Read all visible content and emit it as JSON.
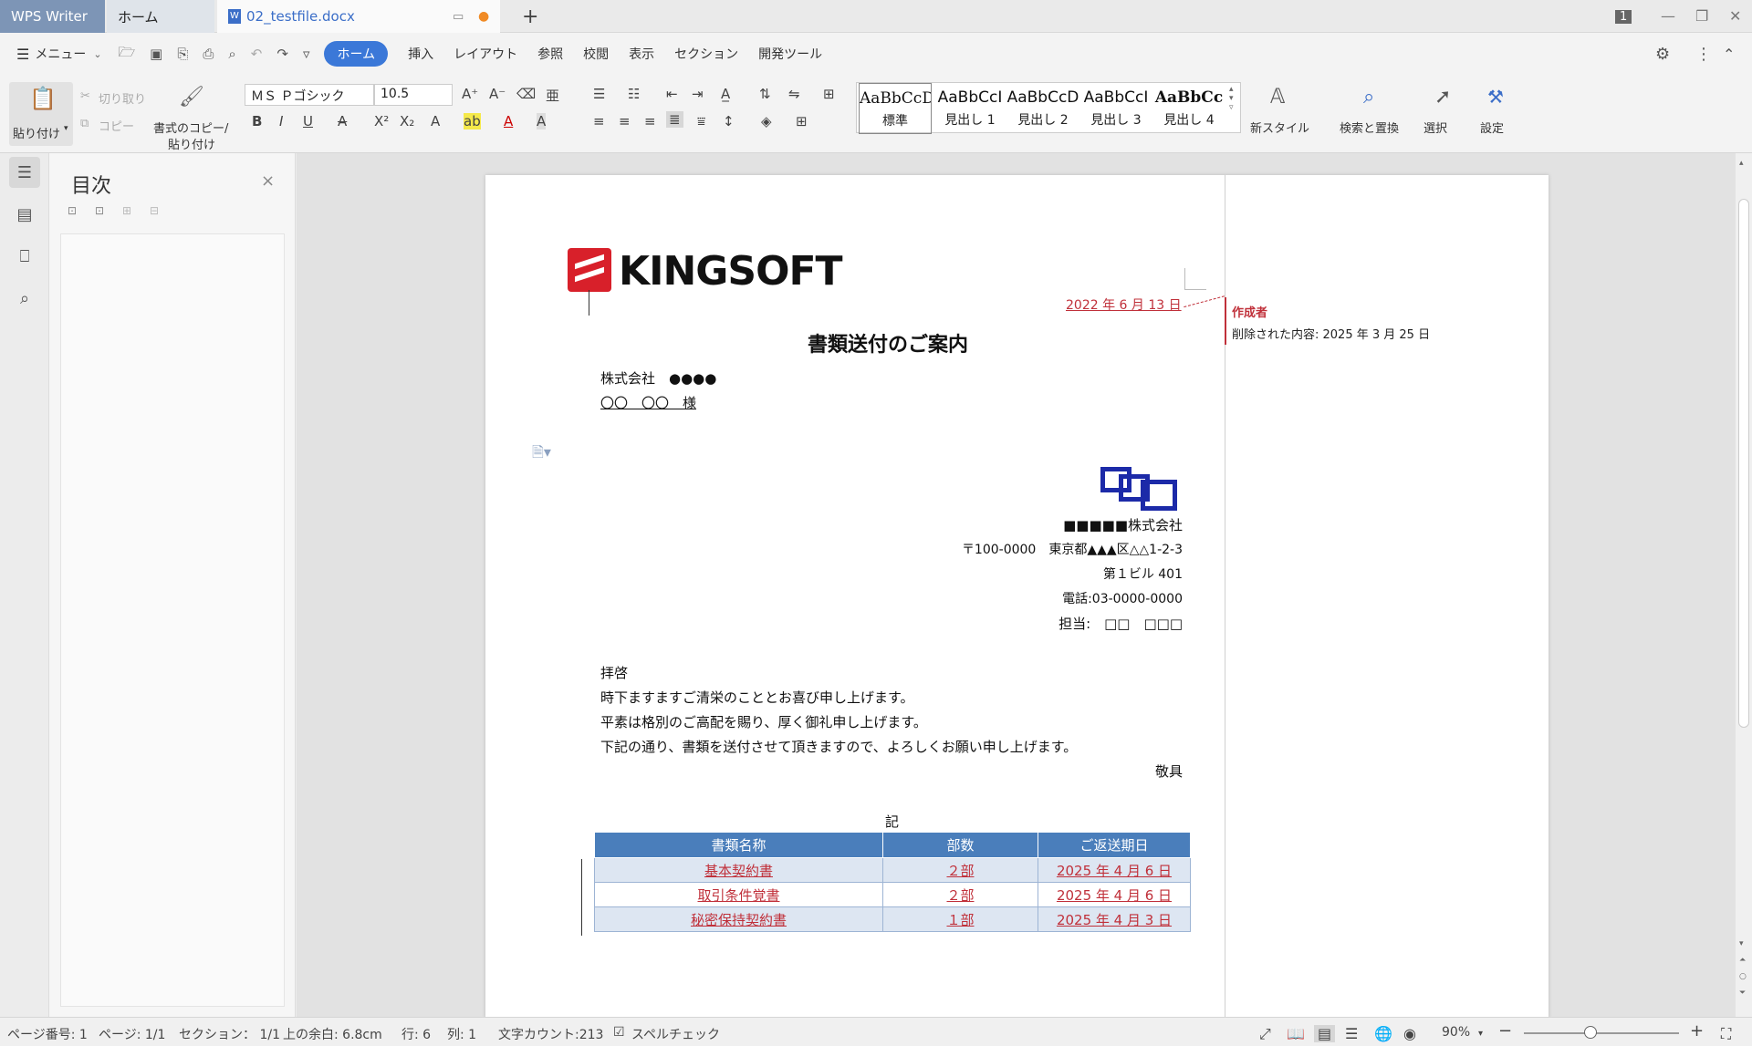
{
  "titlebar": {
    "app": "WPS Writer",
    "home_tab": "ホーム",
    "doc_tab": "02_testfile.docx",
    "add": "+",
    "badge": "1"
  },
  "menubar": {
    "menu": "メニュー",
    "items": [
      "ホーム",
      "挿入",
      "レイアウト",
      "参照",
      "校閲",
      "表示",
      "セクション",
      "開発ツール"
    ]
  },
  "ribbon": {
    "paste": "貼り付け",
    "cut": "切り取り",
    "copy": "コピー",
    "format_copy_1": "書式のコピー/",
    "format_copy_2": "貼り付け",
    "font_name": "ＭＳ Ｐゴシック",
    "font_size": "10.5",
    "new_style": "新スタイル",
    "find_replace": "検索と置換",
    "select": "選択",
    "settings": "設定",
    "styles": [
      {
        "preview": "AaBbCcD",
        "name": "標準"
      },
      {
        "preview": "AaBbCcI",
        "name": "見出し 1"
      },
      {
        "preview": "AaBbCcD",
        "name": "見出し 2"
      },
      {
        "preview": "AaBbCcI",
        "name": "見出し 3"
      },
      {
        "preview": "AaBbCc",
        "name": "見出し 4"
      }
    ]
  },
  "toc": {
    "title": "目次",
    "close": "×"
  },
  "document": {
    "logo": "KINGSOFT",
    "date": "2022 年 6 月 13 日",
    "title": "書類送付のご案内",
    "recipient_company": "株式会社　●●●●",
    "recipient_person": "〇〇　〇〇　様",
    "sender_company": "■■■■■株式会社",
    "sender_address": "〒100-0000　東京都▲▲▲区△△1-2-3",
    "sender_building": "第１ビル 401",
    "sender_phone": "電話:03-0000-0000",
    "sender_contact": "担当:　□□　□□□",
    "body": [
      "拝啓",
      "時下ますますご清栄のこととお喜び申し上げます。",
      "平素は格別のご高配を賜り、厚く御礼申し上げます。",
      "下記の通り、書類を送付させて頂きますので、よろしくお願い申し上げます。"
    ],
    "closing": "敬具",
    "ki": "記",
    "table": {
      "headers": [
        "書類名称",
        "部数",
        "ご返送期日"
      ],
      "rows": [
        [
          "基本契約書",
          "２部",
          "2025 年 4 月 6 日"
        ],
        [
          "取引条件覚書",
          "２部",
          "2025 年 4 月 6 日"
        ],
        [
          "秘密保持契約書",
          "１部",
          "2025 年 4 月 3 日"
        ]
      ]
    }
  },
  "comment": {
    "author": "作成者",
    "text": "削除された内容: 2025 年 3 月 25 日"
  },
  "statusbar": {
    "page_no": "ページ番号: 1",
    "pages": "ページ: 1/1",
    "section": "セクション： 1/1",
    "top_margin": "上の余白: 6.8cm",
    "row": "行: 6",
    "col": "列: 1",
    "word_count": "文字カウント:213",
    "spell": "スペルチェック",
    "zoom": "90%"
  }
}
